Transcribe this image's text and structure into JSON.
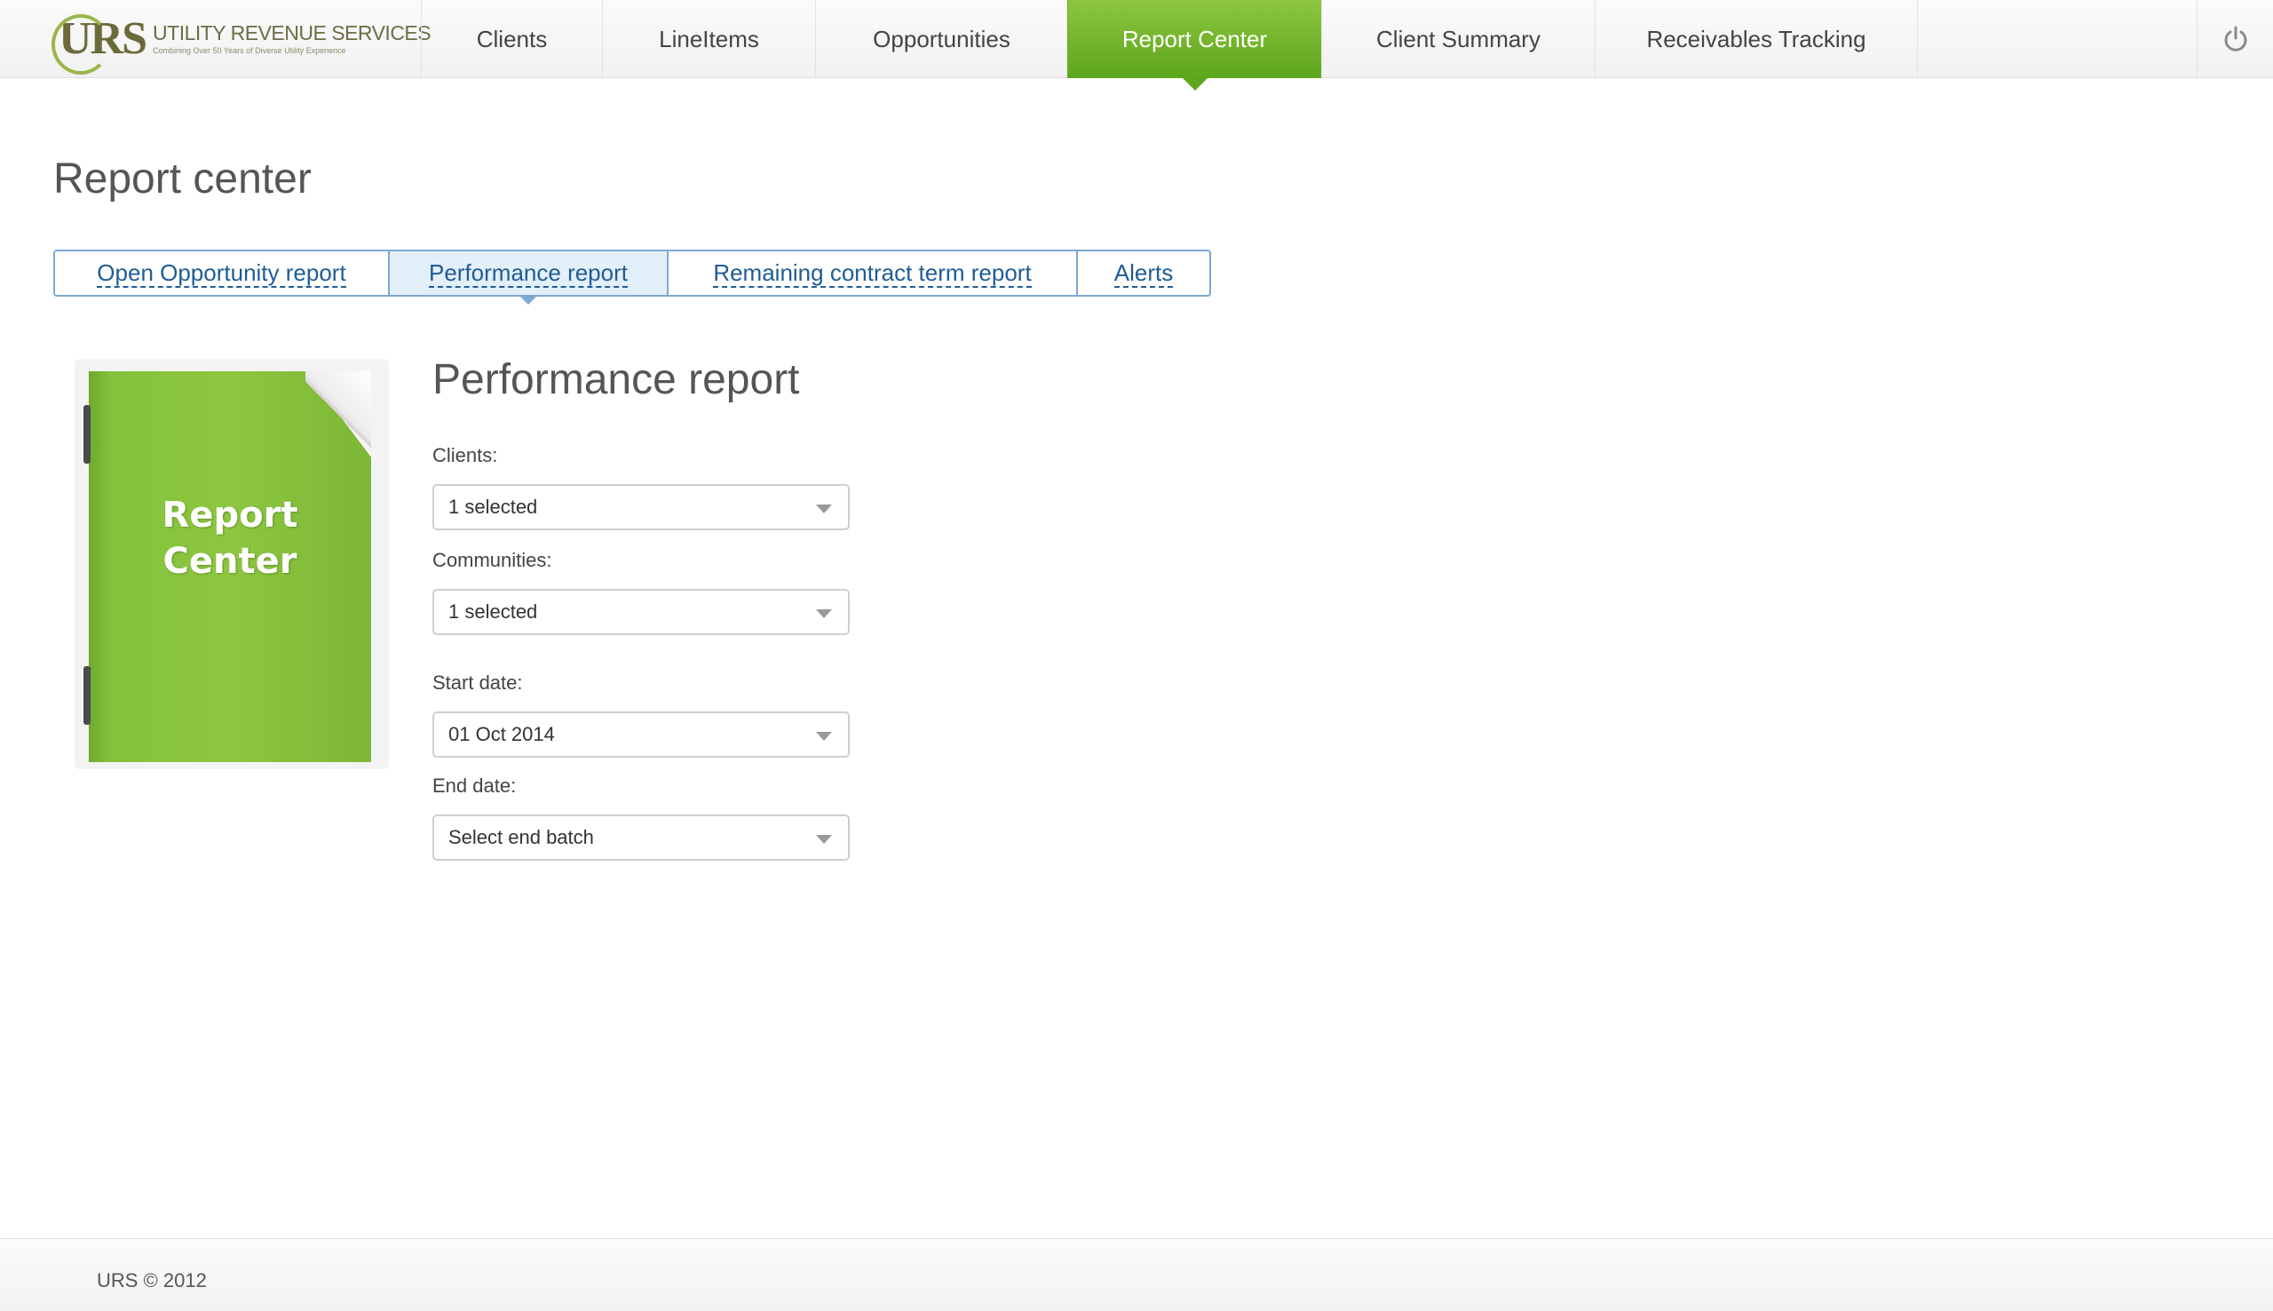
{
  "header": {
    "logo": {
      "mark": "URS",
      "name": "UTILITY REVENUE SERVICES",
      "tagline": "Combining Over 50 Years of Diverse Utility Experience"
    },
    "nav": [
      {
        "label": "Clients",
        "active": false
      },
      {
        "label": "LineItems",
        "active": false
      },
      {
        "label": "Opportunities",
        "active": false
      },
      {
        "label": "Report Center",
        "active": true
      },
      {
        "label": "Client Summary",
        "active": false
      },
      {
        "label": "Receivables Tracking",
        "active": false
      }
    ],
    "power_icon": "power-icon"
  },
  "page": {
    "title": "Report center"
  },
  "subtabs": [
    {
      "label": "Open Opportunity report",
      "active": false
    },
    {
      "label": "Performance report",
      "active": true
    },
    {
      "label": "Remaining contract term report",
      "active": false
    },
    {
      "label": "Alerts",
      "active": false
    }
  ],
  "illustration": {
    "line1": "Report",
    "line2": "Center"
  },
  "form": {
    "title": "Performance report",
    "clients": {
      "label": "Clients:",
      "value": "1 selected"
    },
    "communities": {
      "label": "Communities:",
      "value": "1 selected"
    },
    "start_date": {
      "label": "Start date:",
      "value": "01 Oct 2014"
    },
    "end_date": {
      "label": "End date:",
      "value": "Select end batch"
    }
  },
  "footer": {
    "copyright": "URS © 2012"
  },
  "colors": {
    "accent_green": "#8dc63f",
    "link_blue": "#1f5c96",
    "tab_border": "#7ea9d2"
  }
}
